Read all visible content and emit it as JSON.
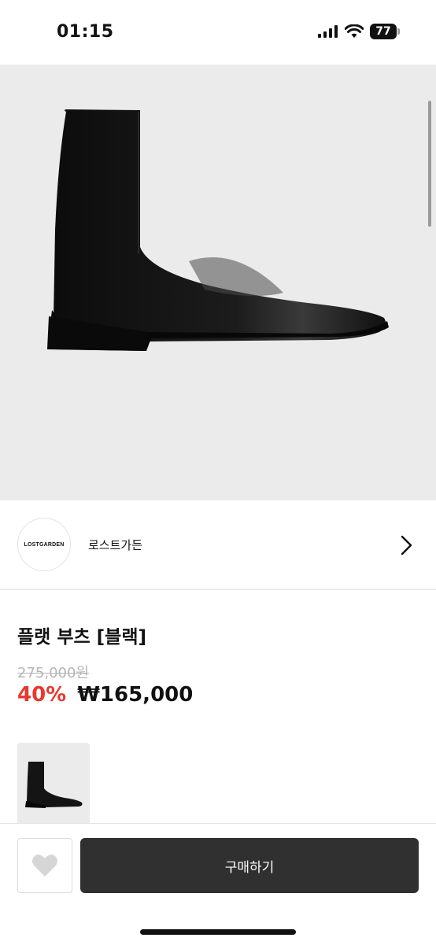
{
  "status_bar": {
    "time": "01:15",
    "battery_level": "77",
    "icons": [
      "signal-icon",
      "wifi-icon",
      "battery-icon"
    ]
  },
  "product": {
    "image_alt_name": "boot-photo",
    "title": "플랫 부츠 [블랙]",
    "original_price": "275,000원",
    "discount": "40%",
    "sale_price": "₩165,000"
  },
  "seller": {
    "logo_text": "LOSTGARDEN",
    "name": "로스트가든"
  },
  "actions": {
    "buy_label": "구매하기",
    "wishlist_icon": "heart-icon"
  },
  "colors": {
    "discount": "#e8382f",
    "buy_button": "#303030",
    "image_bg": "#ebebeb"
  }
}
